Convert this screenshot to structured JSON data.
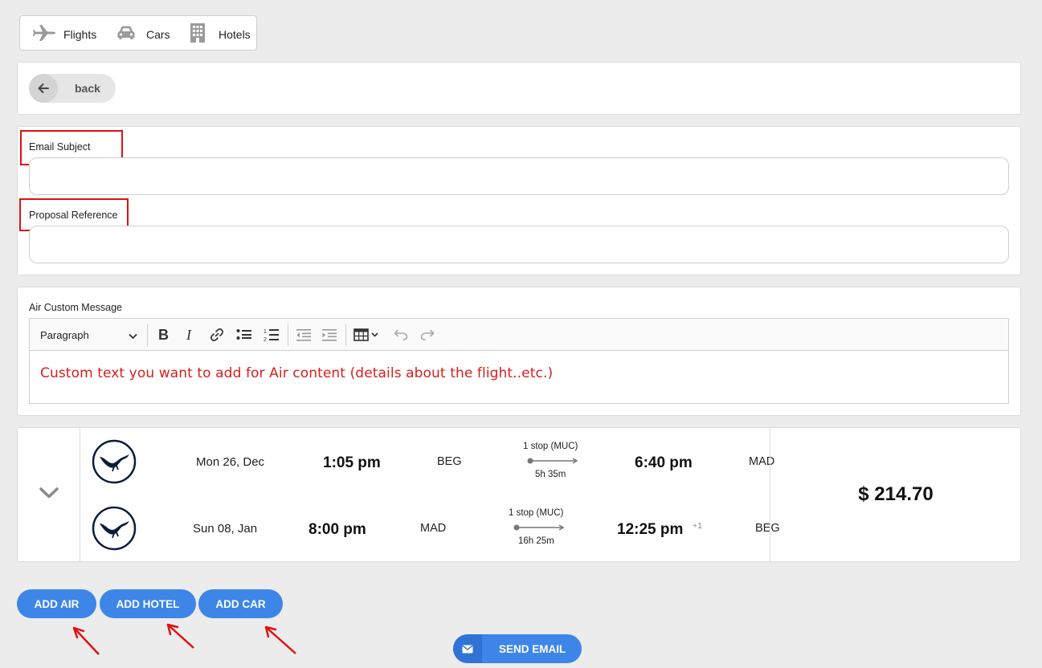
{
  "nav_tabs": [
    {
      "label": "Flights",
      "icon": "plane-icon"
    },
    {
      "label": "Cars",
      "icon": "car-icon"
    },
    {
      "label": "Hotels",
      "icon": "building-icon"
    }
  ],
  "back_button": {
    "label": "back",
    "icon": "arrow-left-icon"
  },
  "form": {
    "email_subject_label": "Email Subject",
    "email_subject_value": "",
    "proposal_reference_label": "Proposal Reference",
    "proposal_reference_value": ""
  },
  "editor": {
    "label": "Air Custom Message",
    "block_format": "Paragraph",
    "toolbar_icons": [
      "bold-icon",
      "italic-icon",
      "link-icon",
      "bulleted-list-icon",
      "numbered-list-icon",
      "outdent-icon",
      "indent-icon",
      "table-icon",
      "undo-icon",
      "redo-icon"
    ],
    "content": "Custom text you want to add for Air content (details about the flight..etc.)"
  },
  "flight": {
    "price": "$ 214.70",
    "segments": [
      {
        "date": "Mon 26, Dec",
        "depart_time": "1:05 pm",
        "origin": "BEG",
        "stops": "1 stop (MUC)",
        "duration": "5h 35m",
        "arrive_time": "6:40 pm",
        "day_offset": "",
        "destination": "MAD"
      },
      {
        "date": "Sun 08, Jan",
        "depart_time": "8:00 pm",
        "origin": "MAD",
        "stops": "1 stop (MUC)",
        "duration": "16h 25m",
        "arrive_time": "12:25 pm",
        "day_offset": "+1",
        "destination": "BEG"
      }
    ]
  },
  "actions": {
    "add_air": "ADD AIR",
    "add_hotel": "ADD HOTEL",
    "add_car": "ADD CAR",
    "send_email": "SEND EMAIL"
  },
  "colors": {
    "primary_button": "#3d86e8",
    "highlight_annotation": "#e01010",
    "custom_text": "#d81e1e"
  }
}
